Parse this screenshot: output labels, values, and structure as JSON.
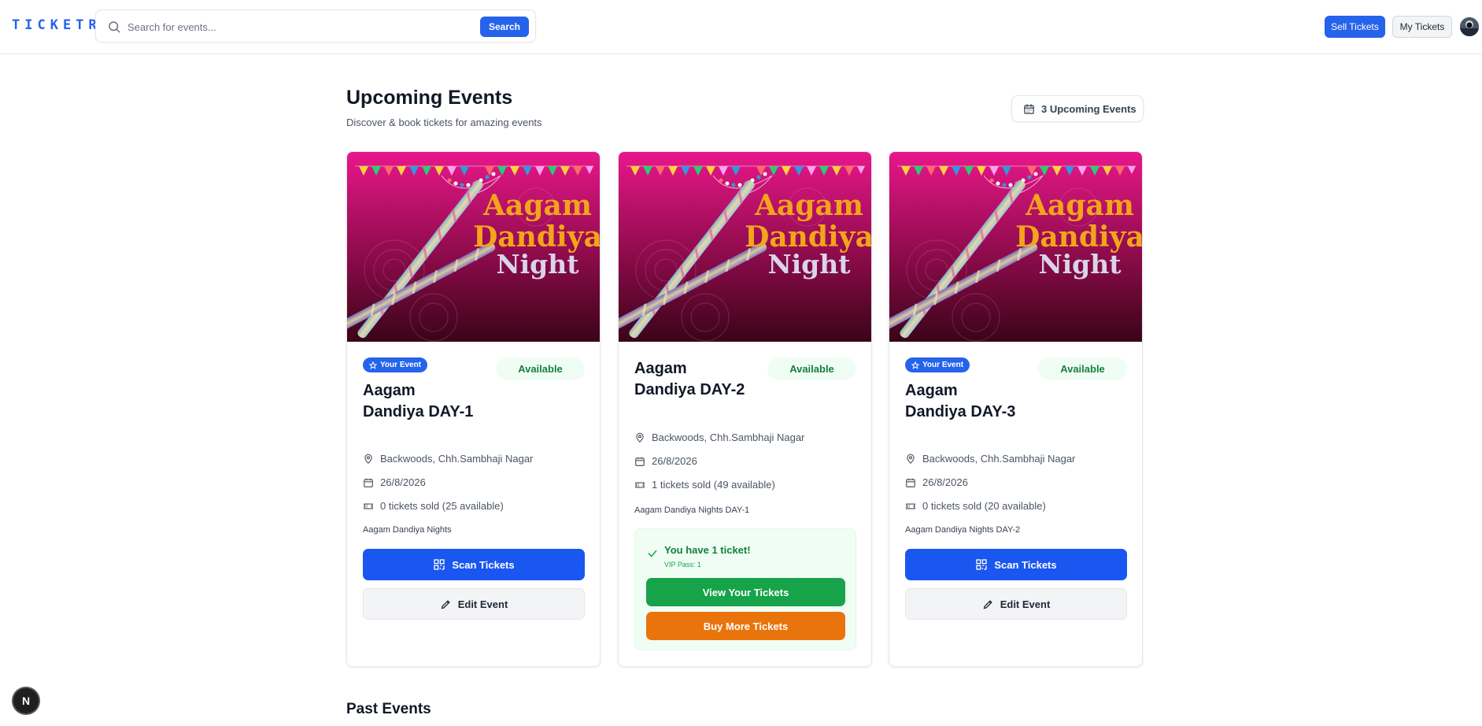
{
  "header": {
    "logo": "TICKETR",
    "search_placeholder": "Search for events...",
    "search_button": "Search",
    "sell_tickets": "Sell Tickets",
    "my_tickets": "My Tickets"
  },
  "main": {
    "title": "Upcoming Events",
    "subtitle": "Discover & book tickets for amazing events",
    "upcoming_count_label": "3 Upcoming Events",
    "past_title": "Past Events"
  },
  "image_text": {
    "line1": "Aagam",
    "line2": "Dandiya",
    "line3": "Night"
  },
  "colors": {
    "accent": "#2563eb",
    "available": "#15803d",
    "view_tickets": "#16a34a",
    "buy_more": "#ea740c",
    "poster_top": "#e8178a",
    "poster_bottom": "#3a0418"
  },
  "events": [
    {
      "badge": "Your Event",
      "status": "Available",
      "title": "Aagam Dandiya DAY-1",
      "location": "Backwoods, Chh.Sambhaji Nagar",
      "date": "26/8/2026",
      "tickets": "0 tickets sold (25 available)",
      "description": "Aagam Dandiya Nights",
      "scan_label": "Scan Tickets",
      "edit_label": "Edit Event"
    },
    {
      "status": "Available",
      "title": "Aagam Dandiya DAY-2",
      "location": "Backwoods, Chh.Sambhaji Nagar",
      "date": "26/8/2026",
      "tickets": "1 tickets sold (49 available)",
      "description": "Aagam Dandiya Nights DAY-1",
      "owned_title": "You have 1 ticket!",
      "owned_sub": "VIP Pass: 1",
      "view_label": "View Your Tickets",
      "buy_label": "Buy More Tickets"
    },
    {
      "badge": "Your Event",
      "status": "Available",
      "title": "Aagam Dandiya DAY-3",
      "location": "Backwoods, Chh.Sambhaji Nagar",
      "date": "26/8/2026",
      "tickets": "0 tickets sold (20 available)",
      "description": "Aagam Dandiya Nights DAY-2",
      "scan_label": "Scan Tickets",
      "edit_label": "Edit Event"
    }
  ],
  "dev_badge": "N"
}
